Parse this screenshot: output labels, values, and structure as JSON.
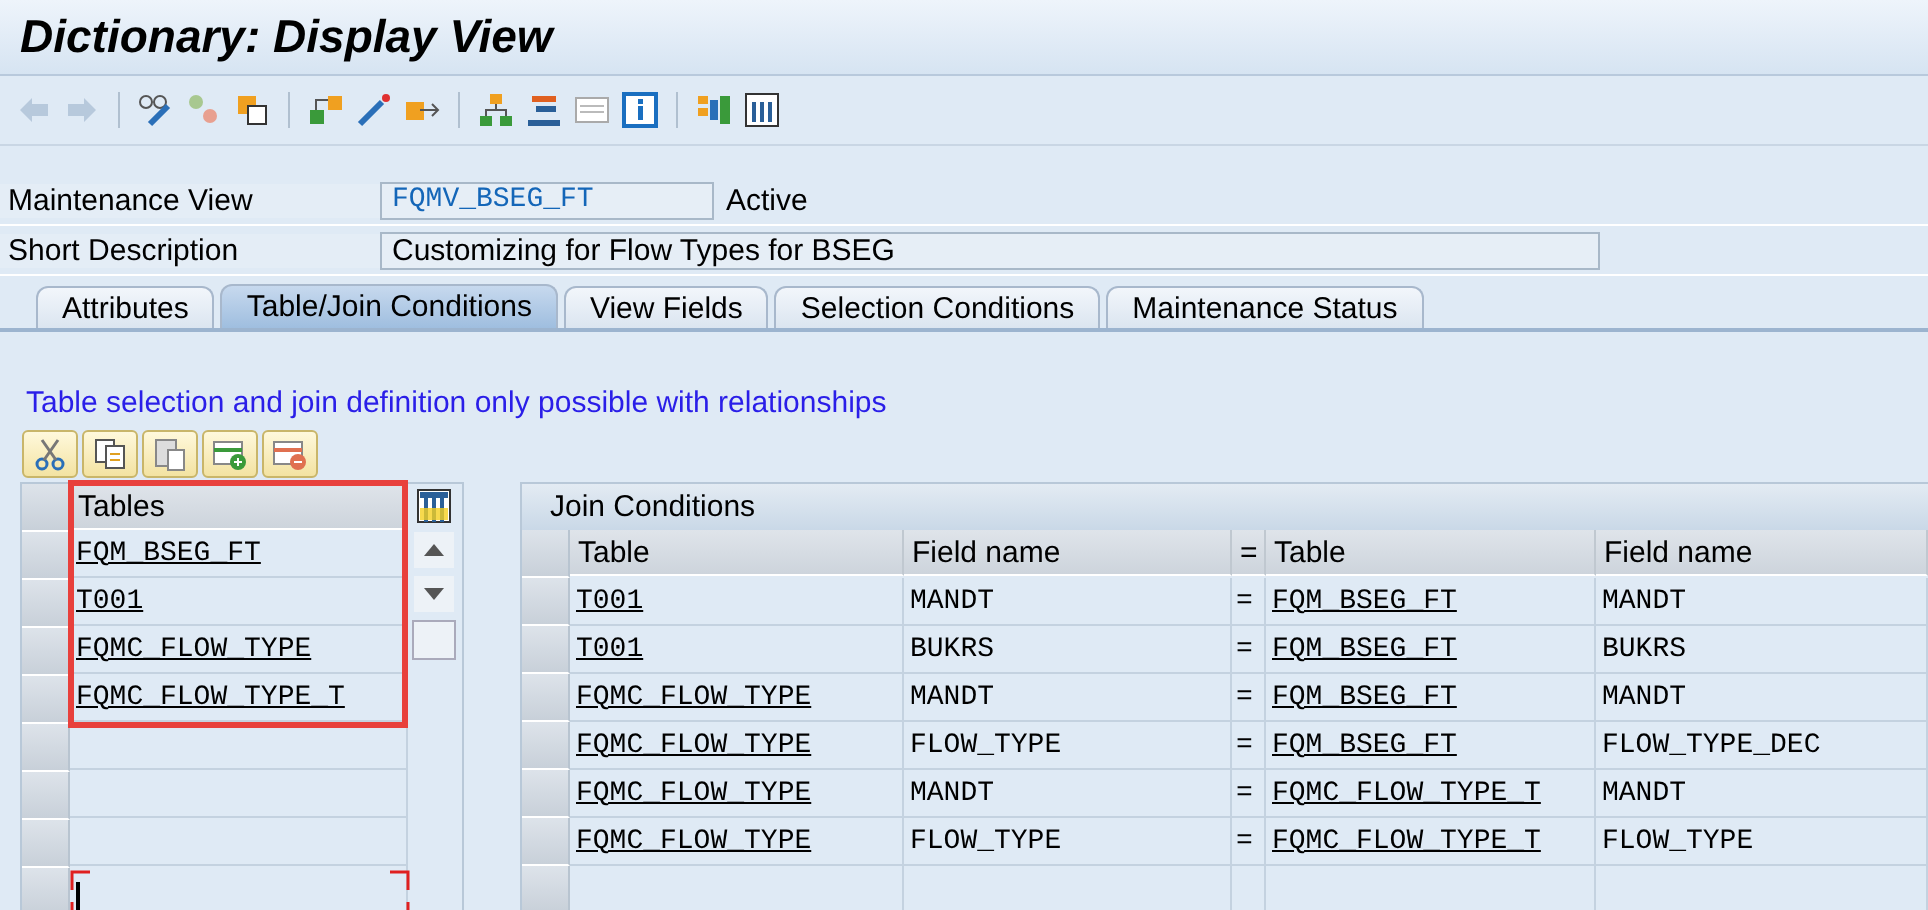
{
  "window": {
    "title": "Dictionary: Display View"
  },
  "fields": [
    {
      "label": "Maintenance View",
      "value": "FQMV_BSEG_FT",
      "status": "Active",
      "kind": "key"
    },
    {
      "label": "Short Description",
      "value": "Customizing for Flow Types for BSEG",
      "kind": "text"
    }
  ],
  "tabs": [
    {
      "label": "Attributes",
      "selected": false
    },
    {
      "label": "Table/Join Conditions",
      "selected": true
    },
    {
      "label": "View Fields",
      "selected": false
    },
    {
      "label": "Selection Conditions",
      "selected": false
    },
    {
      "label": "Maintenance Status",
      "selected": false
    }
  ],
  "info": "Table selection and join definition only possible with relationships",
  "tables_panel": {
    "header": "Tables",
    "rows": [
      "FQM_BSEG_FT",
      "T001",
      "FQMC_FLOW_TYPE",
      "FQMC_FLOW_TYPE_T"
    ]
  },
  "join_conditions": {
    "title": "Join Conditions",
    "columns": [
      "Table",
      "Field name",
      "=",
      "Table",
      "Field name"
    ],
    "rows": [
      [
        "T001",
        "MANDT",
        "=",
        "FQM_BSEG_FT",
        "MANDT"
      ],
      [
        "T001",
        "BUKRS",
        "=",
        "FQM_BSEG_FT",
        "BUKRS"
      ],
      [
        "FQMC_FLOW_TYPE",
        "MANDT",
        "=",
        "FQM_BSEG_FT",
        "MANDT"
      ],
      [
        "FQMC_FLOW_TYPE",
        "FLOW_TYPE",
        "=",
        "FQM_BSEG_FT",
        "FLOW_TYPE_DEC"
      ],
      [
        "FQMC_FLOW_TYPE",
        "MANDT",
        "=",
        "FQMC_FLOW_TYPE_T",
        "MANDT"
      ],
      [
        "FQMC_FLOW_TYPE",
        "FLOW_TYPE",
        "=",
        "FQMC_FLOW_TYPE_T",
        "FLOW_TYPE"
      ]
    ]
  }
}
